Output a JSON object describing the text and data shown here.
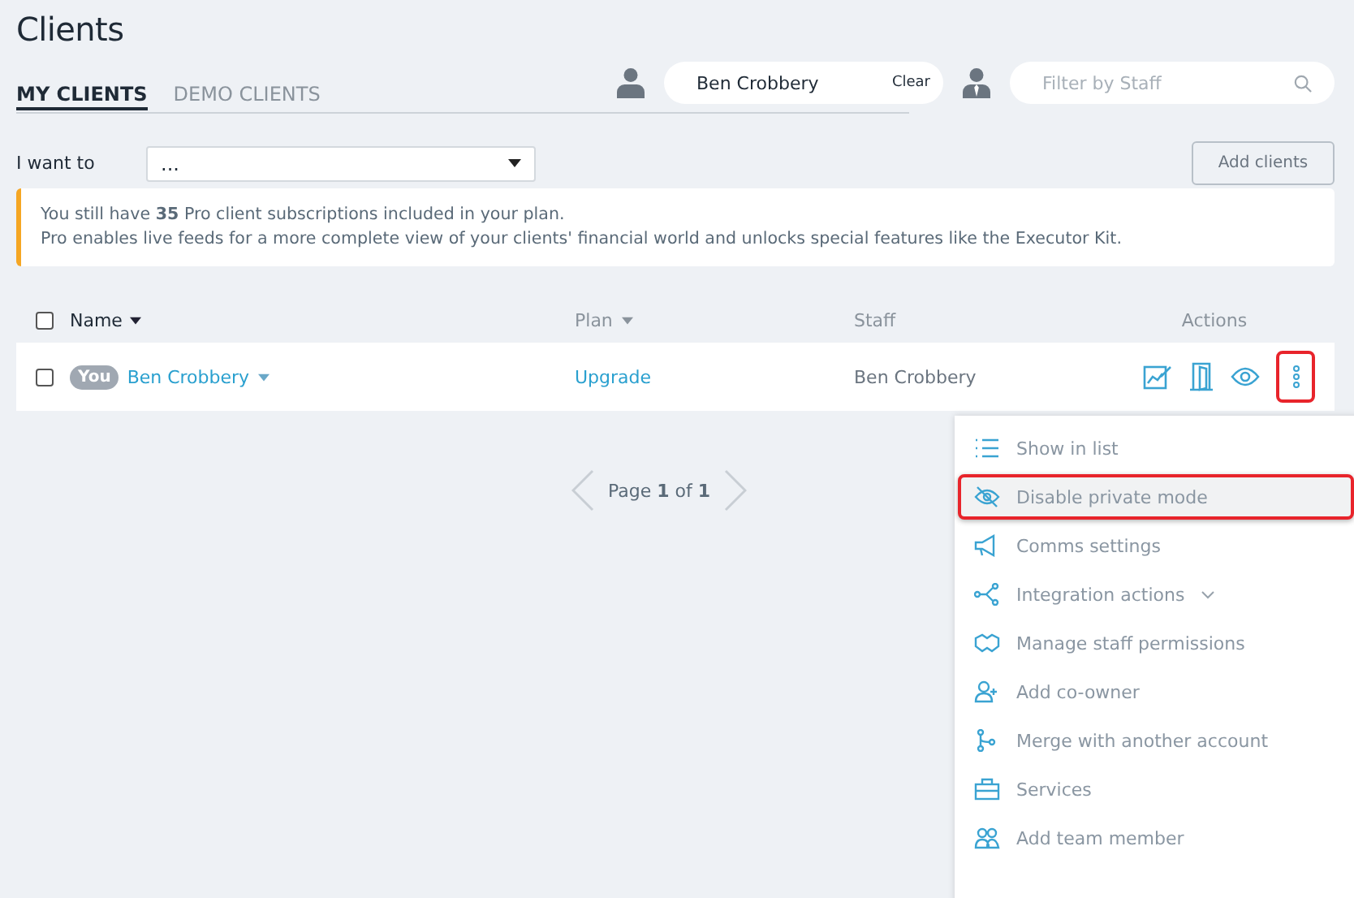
{
  "title": "Clients",
  "tabs": [
    {
      "label": "MY CLIENTS",
      "selected": true
    },
    {
      "label": "DEMO CLIENTS",
      "selected": false
    }
  ],
  "client_filter": {
    "value": "Ben Crobbery",
    "clear": "Clear"
  },
  "staff_filter": {
    "placeholder": "Filter by Staff"
  },
  "action_label": "I want to",
  "action_select": {
    "value": "..."
  },
  "add_button": "Add clients",
  "notice": {
    "line_1": "You still have **35** Pro client subscriptions included in your plan.",
    "line_2": "Pro enables live feeds for a more complete view of your clients' financial world and unlocks special features like the Executor Kit."
  },
  "table": {
    "select_all_checked": false,
    "columns": [
      "Name",
      "Plan",
      "Staff",
      "Actions"
    ],
    "rows": [
      {
        "checked": false,
        "badge": "You",
        "name": "Ben Crobbery",
        "plan": "Upgrade",
        "staff": "Ben Crobbery",
        "menu_highlighted": true
      }
    ]
  },
  "pagination": "Page **1** of **1**",
  "menu": [
    {
      "label": "Show in list",
      "has_submenu": false,
      "highlighted": false
    },
    {
      "label": "Disable private mode",
      "has_submenu": false,
      "highlighted": true
    },
    {
      "label": "Comms settings",
      "has_submenu": false,
      "highlighted": false
    },
    {
      "label": "Integration actions",
      "has_submenu": true,
      "highlighted": false
    },
    {
      "label": "Manage staff permissions",
      "has_submenu": false,
      "highlighted": false
    },
    {
      "label": "Add co-owner",
      "has_submenu": false,
      "highlighted": false
    },
    {
      "label": "Merge with another account",
      "has_submenu": false,
      "highlighted": false
    },
    {
      "label": "Services",
      "has_submenu": false,
      "highlighted": false
    },
    {
      "label": "Add team member",
      "has_submenu": false,
      "highlighted": false
    }
  ]
}
